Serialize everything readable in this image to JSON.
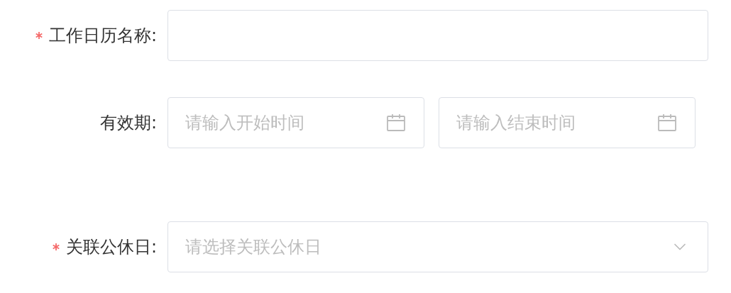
{
  "form": {
    "fields": [
      {
        "kind": "text",
        "label": "工作日历名称:",
        "required": true
      },
      {
        "kind": "daterange",
        "label": "有效期:",
        "required": false,
        "inputs": [
          {
            "placeholder": "请输入开始时间"
          },
          {
            "placeholder": "请输入结束时间"
          }
        ]
      },
      {
        "kind": "select",
        "label": "关联公休日:",
        "required": true,
        "placeholder": "请选择关联公休日"
      }
    ]
  }
}
